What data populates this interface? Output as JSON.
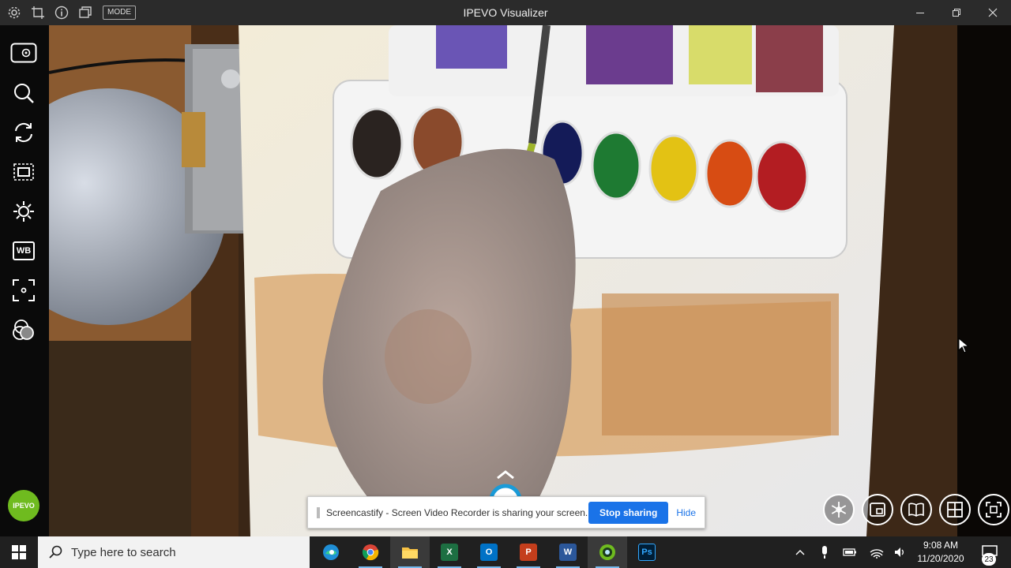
{
  "window": {
    "title": "IPEVO Visualizer",
    "mode_label": "MODE"
  },
  "sidebar": {
    "tools": [
      "camera-source-icon",
      "zoom-icon",
      "rotate-icon",
      "crop-icon",
      "brightness-icon",
      "white-balance-icon",
      "focus-icon",
      "color-filter-icon"
    ],
    "wb_label": "WB",
    "brand": "IPEVO"
  },
  "bottom_tools": [
    "freeze-icon",
    "picture-in-picture-icon",
    "book-mode-icon",
    "grid-icon",
    "fit-screen-icon"
  ],
  "share_bar": {
    "message": "Screencastify - Screen Video Recorder is sharing your screen.",
    "stop_label": "Stop sharing",
    "hide_label": "Hide"
  },
  "taskbar": {
    "search_placeholder": "Type here to search",
    "apps": [
      {
        "name": "edge",
        "label": ""
      },
      {
        "name": "chrome",
        "label": ""
      },
      {
        "name": "file-explorer",
        "label": ""
      },
      {
        "name": "excel",
        "label": "X",
        "color": "#1d6f42"
      },
      {
        "name": "outlook",
        "label": "O",
        "color": "#0072c6"
      },
      {
        "name": "powerpoint",
        "label": "P",
        "color": "#c43e1c"
      },
      {
        "name": "word",
        "label": "W",
        "color": "#2b579a"
      },
      {
        "name": "ipevo-visualizer",
        "label": ""
      },
      {
        "name": "photoshop",
        "label": "Ps",
        "color": "#001e36"
      }
    ],
    "time": "9:08 AM",
    "date": "11/20/2020",
    "notification_count": "23"
  },
  "colors": {
    "titlebar": "#2b2b2b",
    "sidebar": "#0a0a0a",
    "taskbar": "#202020",
    "accent": "#1a73e8",
    "ipevo_green": "#6fbb1f"
  }
}
